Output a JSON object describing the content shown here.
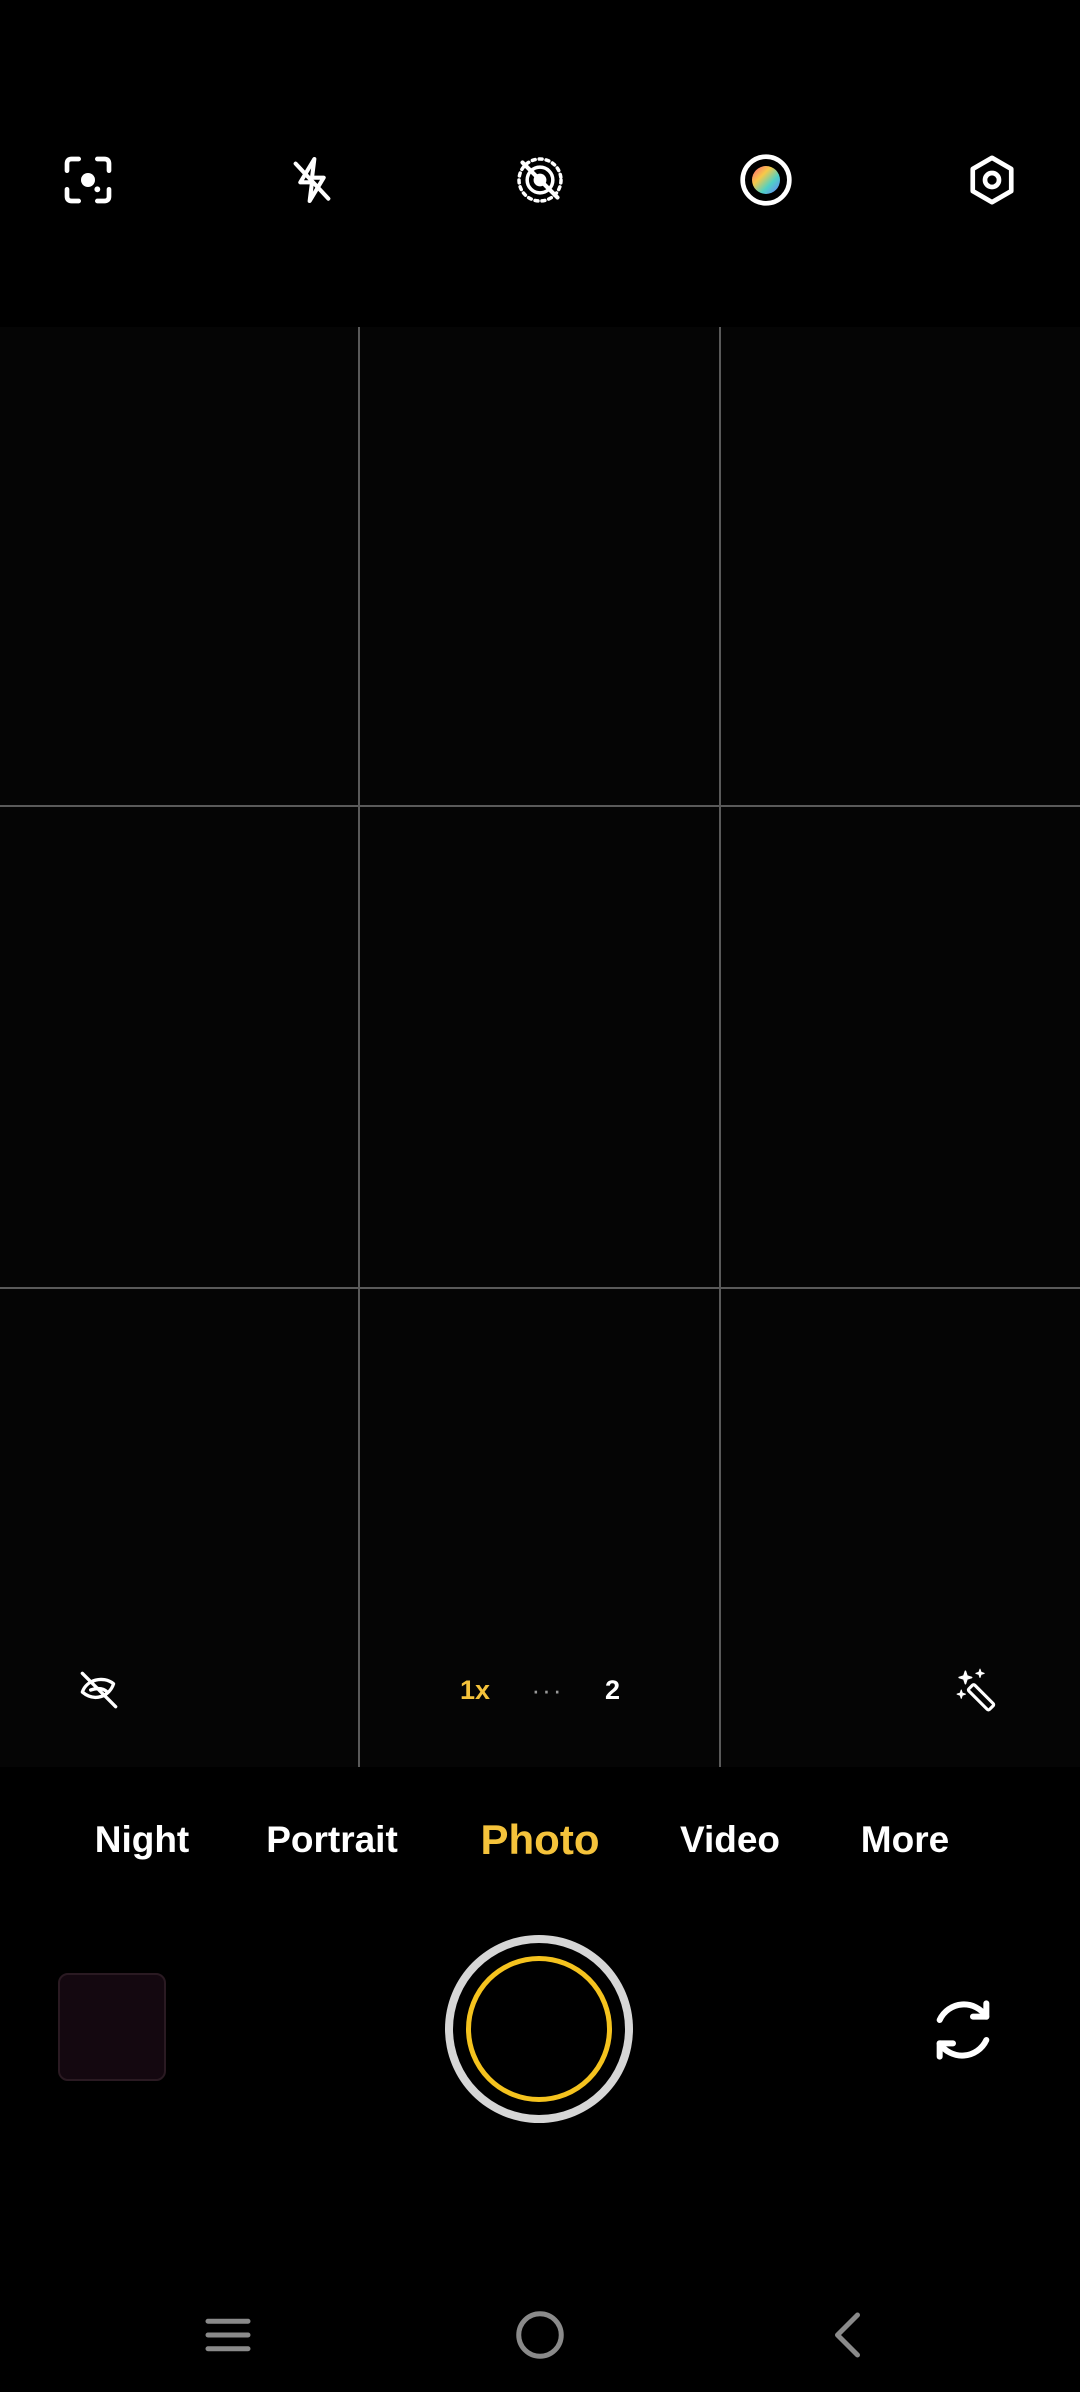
{
  "top_bar": {
    "icons": [
      "lens-scan-icon",
      "flash-off-icon",
      "live-photo-off-icon",
      "color-filter-icon",
      "settings-icon"
    ]
  },
  "viewfinder": {
    "grid": "3x3"
  },
  "viewfinder_controls": {
    "zoom_active": "1x",
    "zoom_dots": "···",
    "zoom_next": "2",
    "left_icon": "beauty-off-icon",
    "right_icon": "magic-wand-icon"
  },
  "modes": {
    "items": [
      {
        "label": "Night"
      },
      {
        "label": "Portrait"
      },
      {
        "label": "Photo"
      },
      {
        "label": "Video"
      },
      {
        "label": "More"
      }
    ],
    "selected": "Photo"
  },
  "controls": {
    "thumbnail": "gallery-thumbnail",
    "shutter": "shutter-button",
    "flip": "switch-camera-icon"
  },
  "nav": {
    "icons": [
      "recent-apps-icon",
      "home-icon",
      "back-icon"
    ]
  },
  "colors": {
    "accent": "#f5c33b",
    "text": "#ffffff",
    "grid": "#5a5a5a",
    "background": "#000000"
  }
}
